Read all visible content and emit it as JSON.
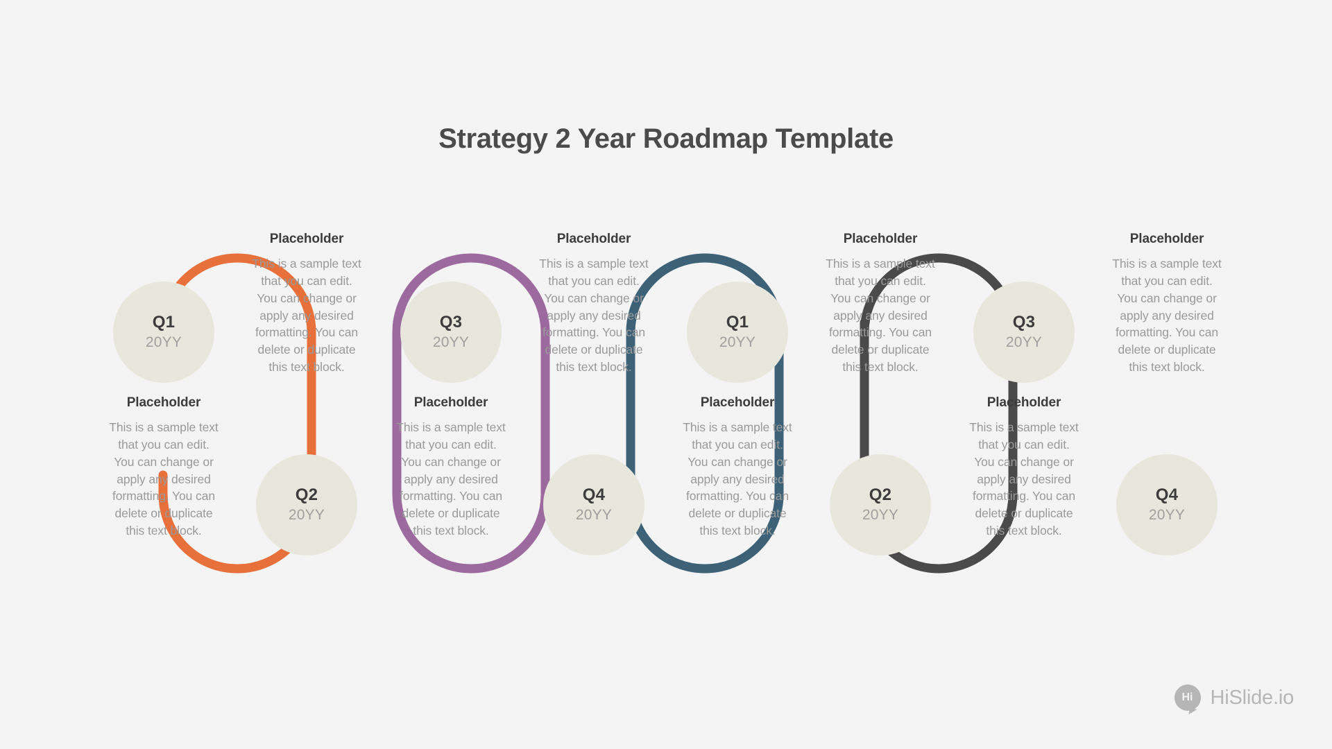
{
  "title": "Strategy 2 Year Roadmap Template",
  "sample_text": "This is a sample text that you can edit. You can change or apply any desired formatting. You can delete or duplicate this text block.",
  "placeholder_heading": "Placeholder",
  "year_label": "20YY",
  "colors": {
    "background": "#F5F4F4",
    "circle_fill": "#E7E7DD",
    "heading": "#3C3C3C",
    "body_text": "#9A9A9A",
    "segment_1": "#E8703A",
    "segment_2": "#9C6A9E",
    "segment_3": "#3D6277",
    "segment_4": "#4A4A4A",
    "logo": "#B6B6B6"
  },
  "milestones": [
    {
      "quarter": "Q1",
      "year": "20YY",
      "heading": "Placeholder",
      "text": "This is a sample text that you can edit. You can change or apply any desired formatting. You can delete or duplicate this text block.",
      "color": "#E8703A",
      "position": "top"
    },
    {
      "quarter": "Q2",
      "year": "20YY",
      "heading": "Placeholder",
      "text": "This is a sample text that you can edit. You can change or apply any desired formatting. You can delete or duplicate this text block.",
      "color": "#E8703A",
      "position": "bottom"
    },
    {
      "quarter": "Q3",
      "year": "20YY",
      "heading": "Placeholder",
      "text": "This is a sample text that you can edit. You can change or apply any desired formatting. You can delete or duplicate this text block.",
      "color": "#9C6A9E",
      "position": "top"
    },
    {
      "quarter": "Q4",
      "year": "20YY",
      "heading": "Placeholder",
      "text": "This is a sample text that you can edit. You can change or apply any desired formatting. You can delete or duplicate this text block.",
      "color": "#9C6A9E",
      "position": "bottom"
    },
    {
      "quarter": "Q1",
      "year": "20YY",
      "heading": "Placeholder",
      "text": "This is a sample text that you can edit. You can change or apply any desired formatting. You can delete or duplicate this text block.",
      "color": "#3D6277",
      "position": "top"
    },
    {
      "quarter": "Q2",
      "year": "20YY",
      "heading": "Placeholder",
      "text": "This is a sample text that you can edit. You can change or apply any desired formatting. You can delete or duplicate this text block.",
      "color": "#3D6277",
      "position": "bottom"
    },
    {
      "quarter": "Q3",
      "year": "20YY",
      "heading": "Placeholder",
      "text": "This is a sample text that you can edit. You can change or apply any desired formatting. You can delete or duplicate this text block.",
      "color": "#4A4A4A",
      "position": "top"
    },
    {
      "quarter": "Q4",
      "year": "20YY",
      "heading": "Placeholder",
      "text": "This is a sample text that you can edit. You can change or apply any desired formatting. You can delete or duplicate this text block.",
      "color": "#4A4A4A",
      "position": "bottom"
    }
  ],
  "logo": {
    "mark_text": "Hi",
    "wordmark": "HiSlide.io"
  }
}
